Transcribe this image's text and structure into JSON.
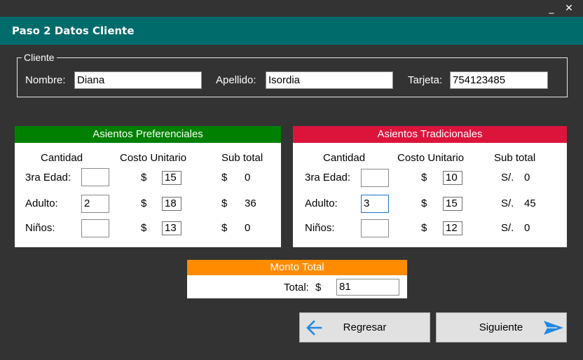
{
  "window": {
    "minimize_glyph": "_",
    "close_glyph": "✕"
  },
  "header": {
    "title": "Paso 2 Datos Cliente",
    "color": "#006b6b"
  },
  "cliente": {
    "legend": "Cliente",
    "nombre_label": "Nombre:",
    "nombre_value": "Diana",
    "apellido_label": "Apellido:",
    "apellido_value": "Isordia",
    "tarjeta_label": "Tarjeta:",
    "tarjeta_value": "754123485"
  },
  "preferenciales": {
    "title": "Asientos Preferenciales",
    "header_color": "#008000",
    "col_cantidad": "Cantidad",
    "col_costo": "Costo Unitario",
    "col_subtotal": "Sub total",
    "rows": [
      {
        "label": "3ra Edad:",
        "qty": "",
        "currency": "$",
        "cost": "15",
        "sub_currency": "$",
        "subtotal": "0"
      },
      {
        "label": "Adulto:",
        "qty": "2",
        "currency": "$",
        "cost": "18",
        "sub_currency": "$",
        "subtotal": "36"
      },
      {
        "label": "Niños:",
        "qty": "",
        "currency": "$",
        "cost": "13",
        "sub_currency": "$",
        "subtotal": "0"
      }
    ]
  },
  "tradicionales": {
    "title": "Asientos Tradicionales",
    "header_color": "#dc143c",
    "col_cantidad": "Cantidad",
    "col_costo": "Costo Unitario",
    "col_subtotal": "Sub total",
    "rows": [
      {
        "label": "3ra Edad:",
        "qty": "",
        "currency": "$",
        "cost": "10",
        "sub_currency": "S/.",
        "subtotal": "0"
      },
      {
        "label": "Adulto:",
        "qty": "3",
        "currency": "$",
        "cost": "15",
        "sub_currency": "S/.",
        "subtotal": "45"
      },
      {
        "label": "Niños:",
        "qty": "",
        "currency": "$",
        "cost": "12",
        "sub_currency": "S/.",
        "subtotal": "0"
      }
    ]
  },
  "total": {
    "title": "Monto Total",
    "header_color": "#ff8c00",
    "label": "Total:",
    "currency": "$",
    "value": "81"
  },
  "buttons": {
    "back_label": "Regresar",
    "back_icon": "arrow-left-icon",
    "next_label": "Siguiente",
    "next_icon": "send-arrow-icon",
    "icon_color": "#1e88e5"
  }
}
